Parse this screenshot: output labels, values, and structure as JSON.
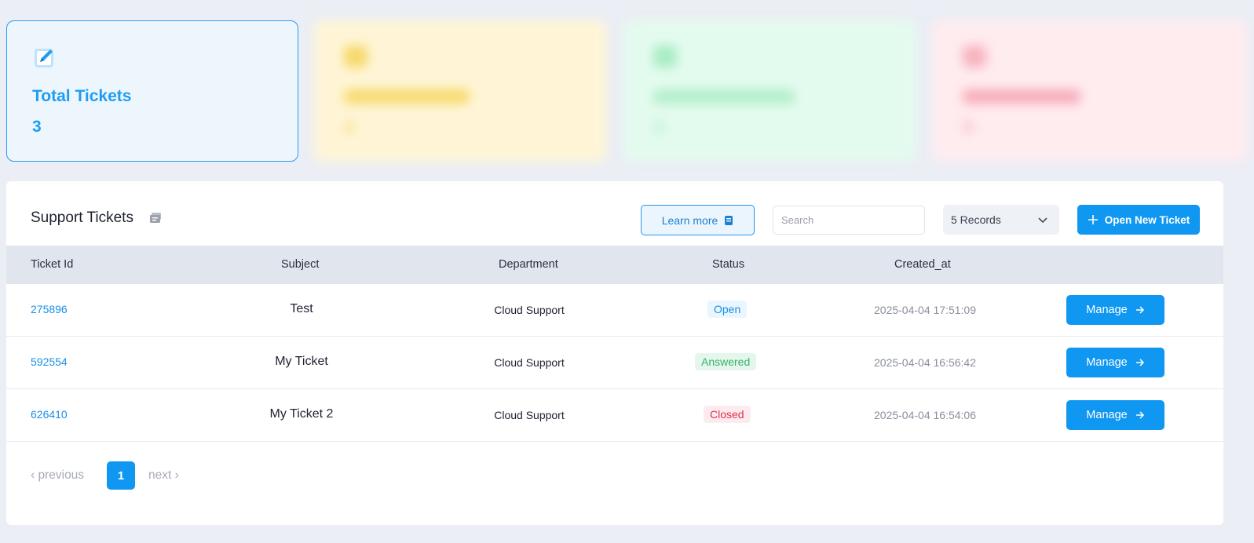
{
  "stats": {
    "total": {
      "title": "Total Tickets",
      "count": "3",
      "icon": "edit-square-icon"
    }
  },
  "panel": {
    "title": "Support Tickets",
    "title_icon": "tickets-icon",
    "learn_more_label": "Learn more",
    "learn_more_icon": "document-icon",
    "search_placeholder": "Search",
    "records_selected": "5 Records",
    "open_ticket_label": "Open New Ticket"
  },
  "table": {
    "headers": [
      "Ticket Id",
      "Subject",
      "Department",
      "Status",
      "Created_at"
    ],
    "rows": [
      {
        "id": "275896",
        "subject": "Test",
        "department": "Cloud Support",
        "status": "Open",
        "created_at": "2025-04-04 17:51:09",
        "action": "Manage"
      },
      {
        "id": "592554",
        "subject": "My Ticket",
        "department": "Cloud Support",
        "status": "Answered",
        "created_at": "2025-04-04 16:56:42",
        "action": "Manage"
      },
      {
        "id": "626410",
        "subject": "My Ticket 2",
        "department": "Cloud Support",
        "status": "Closed",
        "created_at": "2025-04-04 16:54:06",
        "action": "Manage"
      }
    ]
  },
  "pagination": {
    "previous": "‹ previous",
    "current": "1",
    "next": "next ›"
  },
  "colors": {
    "accent": "#0f97f1",
    "open": "#1a8fe8",
    "answered": "#35b36a",
    "closed": "#e0314b"
  }
}
